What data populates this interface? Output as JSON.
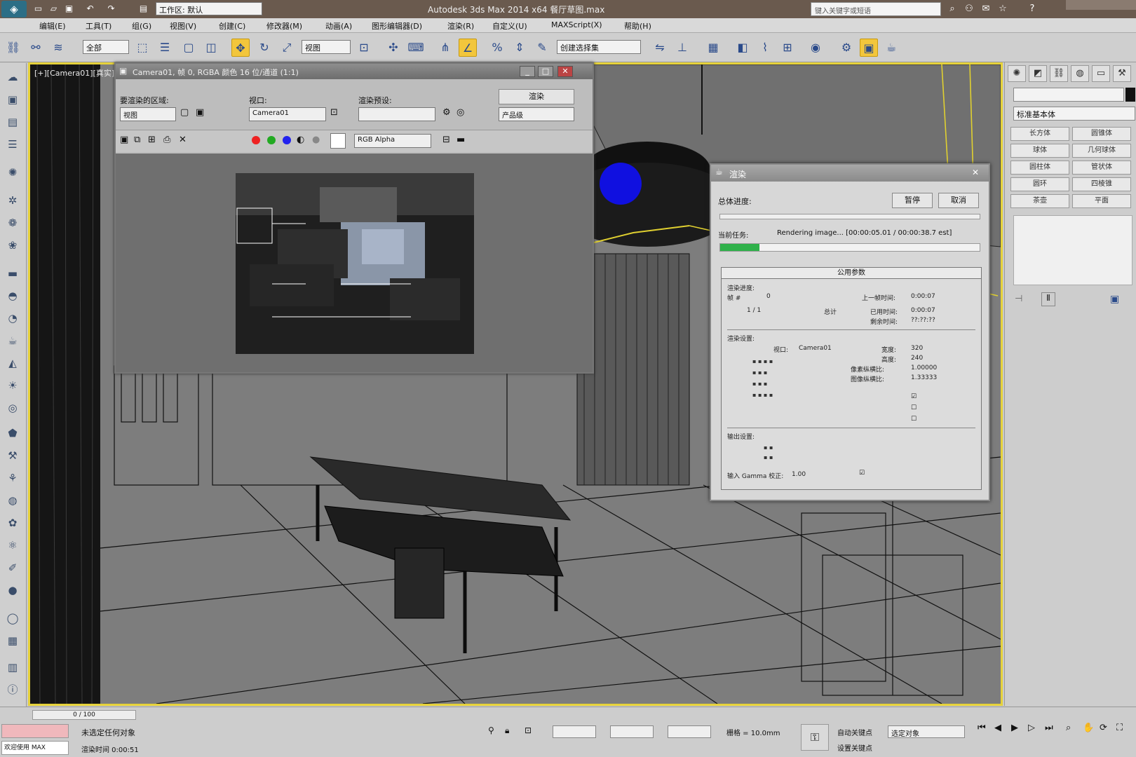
{
  "window": {
    "title": "Autodesk 3ds Max  2014 x64      餐厅草图.max",
    "workspace": "工作区: 默认",
    "search_placeholder": "键入关键字或短语"
  },
  "menu": [
    "编辑(E)",
    "工具(T)",
    "组(G)",
    "视图(V)",
    "创建(C)",
    "修改器(M)",
    "动画(A)",
    "图形编辑器(D)",
    "渲染(R)",
    "自定义(U)",
    "MAXScript(X)",
    "帮助(H)"
  ],
  "toolbar": {
    "selection_filter": "全部",
    "reference_coord": "视图",
    "named_selection": "创建选择集"
  },
  "viewport": {
    "label": "[+][Camera01][真实]"
  },
  "command_panel": {
    "dropdown": "标准基本体",
    "buttons": [
      "长方体",
      "圆锥体",
      "球体",
      "几何球体",
      "圆柱体",
      "管状体",
      "圆环",
      "四棱锥",
      "茶壶",
      "平面"
    ]
  },
  "frame_buffer": {
    "title": "Camera01, 帧 0, RGBA 颜色 16 位/通道 (1:1)",
    "area_to_render_label": "要渲染的区域:",
    "area_to_render_value": "视图",
    "viewport_label": "视口:",
    "viewport_value": "Camera01",
    "preset_label": "渲染预设:",
    "preset_value": "",
    "render_button": "渲染",
    "production_value": "产品级",
    "channel_value": "RGB Alpha"
  },
  "render_dialog": {
    "title": "渲染",
    "pause_button": "暂停",
    "cancel_button": "取消",
    "overall_progress_label": "总体进度:",
    "current_task_label": "当前任务:",
    "current_task_value": "Rendering image...  [00:00:05.01 / 00:00:38.7 est]",
    "progress": 0.15,
    "params_header": "公用参数",
    "render_progress_header": "渲染进度:",
    "frame_label": "帧 #",
    "frame_value": "0",
    "last_frame_time_label": "上一帧时间:",
    "last_frame_time_value": "0:00:07",
    "elapsed_label": "已用时间:",
    "elapsed_value": "0:00:07",
    "remaining_label": "剩余时间:",
    "remaining_value": "??:??:??",
    "count_value": "1 / 1",
    "total_label": "总计",
    "render_settings_header": "渲染设置:",
    "viewport_label": "视口:",
    "viewport_value": "Camera01",
    "width_label": "宽度:",
    "width_value": "320",
    "height_label": "高度:",
    "height_value": "240",
    "aspect_label": "像素纵横比:",
    "aspect_value": "1.00000",
    "image_aspect_label": "图像纵横比:",
    "image_aspect_value": "1.33333",
    "output_header": "输出设置:",
    "gamma_label": "输入 Gamma 校正:",
    "gamma_value": "1.00"
  },
  "status_bar": {
    "selection_info": "未选定任何对象",
    "render_time": "渲染时间 0:00:51",
    "grid_value": "栅格 = 10.0mm",
    "autokey_label": "自动关键点",
    "set_key_label": "设置关键点",
    "selected_dropdown": "选定对象",
    "time_slider": "0 / 100",
    "welcome": "欢迎使用 MAX"
  }
}
